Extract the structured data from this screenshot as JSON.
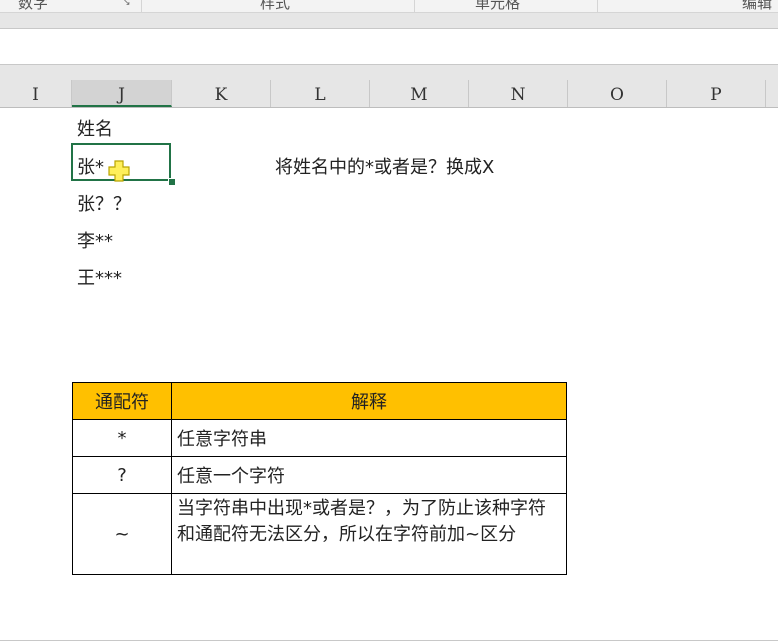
{
  "ribbon": {
    "groups": [
      "数字",
      "样式",
      "单元格",
      "编辑"
    ]
  },
  "columns": [
    "I",
    "J",
    "K",
    "L",
    "M",
    "N",
    "O",
    "P"
  ],
  "selected_column": "J",
  "cells": {
    "j1": "姓名",
    "j2": "张*",
    "j3": "张？？",
    "j4": "李**",
    "j5": "王***"
  },
  "note": "将姓名中的*或者是？换成X",
  "table": {
    "headers": [
      "通配符",
      "解释"
    ],
    "rows": [
      {
        "symbol": "*",
        "desc": "任意字符串"
      },
      {
        "symbol": "?",
        "desc": "任意一个字符"
      },
      {
        "symbol": "~",
        "desc": "当字符串中出现*或者是？，为了防止该种字符和通配符无法区分，所以在字符前加~区分"
      }
    ],
    "header_color": "#FFC000"
  },
  "accent": "#217346"
}
